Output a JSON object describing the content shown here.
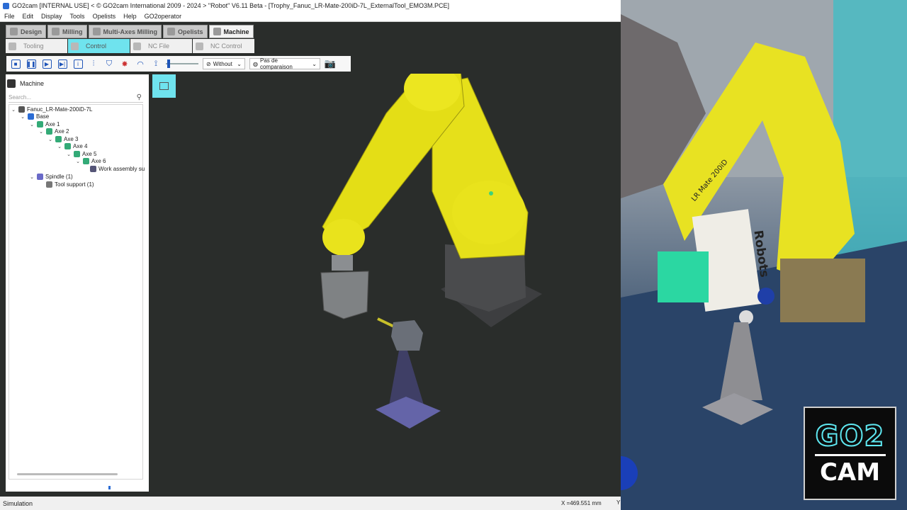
{
  "window": {
    "title": "GO2cam [INTERNAL USE] < © GO2cam International 2009 - 2024 >   \"Robot\"  V6.11 Beta  - [Trophy_Fanuc_LR-Mate-200iD-7L_ExternalTool_EMO3M.PCE]"
  },
  "menu": [
    "File",
    "Edit",
    "Display",
    "Tools",
    "Opelists",
    "Help",
    "GO2operator"
  ],
  "tabs_main": [
    "Design",
    "Milling",
    "Multi-Axes Milling",
    "Opelists",
    "Machine"
  ],
  "tabs_sub": [
    "Tooling",
    "Control",
    "NC File",
    "NC Control"
  ],
  "toolbar": {
    "dropdown_without": "Without",
    "dropdown_comparison": "Pas de comparaison",
    "speed_slider_level": 0.05
  },
  "panel": {
    "title": "Machine",
    "search_placeholder": "Search..."
  },
  "tree": [
    {
      "label": "Fanuc_LR-Mate-200iD-7L",
      "level": 0
    },
    {
      "label": "Base",
      "level": 1
    },
    {
      "label": "Axe 1",
      "level": 2
    },
    {
      "label": "Axe 2",
      "level": 3
    },
    {
      "label": "Axe 3",
      "level": 4
    },
    {
      "label": "Axe 4",
      "level": 5
    },
    {
      "label": "Axe 5",
      "level": 6
    },
    {
      "label": "Axe 6",
      "level": 7
    },
    {
      "label": "Work assembly su",
      "level": 8
    },
    {
      "label": "Spindle (1)",
      "level": 2
    },
    {
      "label": "Tool support (1)",
      "level": 3
    }
  ],
  "status": {
    "mode": "Simulation",
    "coordinate": "X =469.551 mm",
    "trailing": "Y"
  },
  "photo": {
    "book_title": "Robots",
    "robot_label": "LR Mate 200iD"
  },
  "logo": {
    "line1": "GO2",
    "line2": "CAM"
  },
  "colors": {
    "accent_cyan": "#6fe3ee",
    "robot_yellow": "#e6e01a",
    "base_gray": "#4a4b4d",
    "stand_purple": "#5a5a8e"
  },
  "icons": [
    "stop-icon",
    "pause-icon",
    "play-icon",
    "step-icon",
    "info-icon",
    "axes-icon",
    "shield-icon",
    "collision-icon",
    "speed-gauge-icon",
    "robot-path-icon",
    "camera-icon",
    "search-icon"
  ]
}
